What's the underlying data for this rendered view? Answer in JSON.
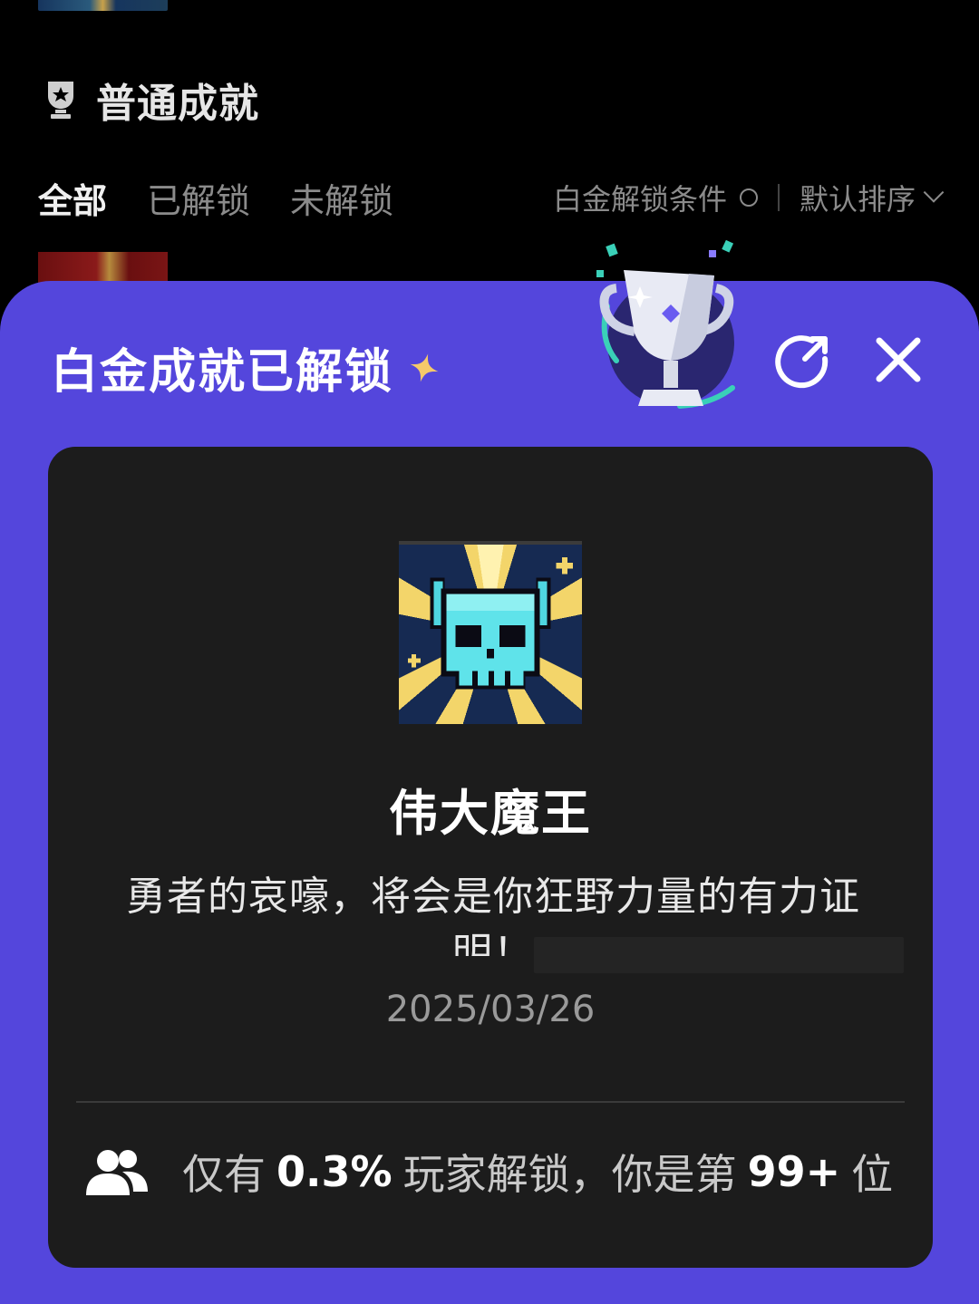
{
  "background": {
    "section_title": "普通成就",
    "filters": [
      {
        "label": "全部",
        "active": true
      },
      {
        "label": "已解锁",
        "active": false
      },
      {
        "label": "未解锁",
        "active": false
      }
    ],
    "platinum_condition": "白金解锁条件",
    "sort_label": "默认排序"
  },
  "modal": {
    "title": "白金成就已解锁",
    "achievement": {
      "name": "伟大魔王",
      "description": "勇者的哀嚎，将会是你狂野力量的有力证明！",
      "date": "2025/03/26"
    },
    "stats": {
      "prefix": "仅有",
      "percent": "0.3%",
      "middle": "玩家解锁，你是第",
      "rank": "99+",
      "suffix": "位"
    }
  },
  "colors": {
    "sheet": "#5446dc",
    "card": "#1c1c1c",
    "page_bg": "#000000",
    "badge_cyan": "#4fd6e0",
    "badge_gold": "#f3d56a"
  },
  "icons": [
    "trophy-icon",
    "sparkle-icon",
    "share-icon",
    "close-icon",
    "people-icon",
    "skull-badge"
  ]
}
